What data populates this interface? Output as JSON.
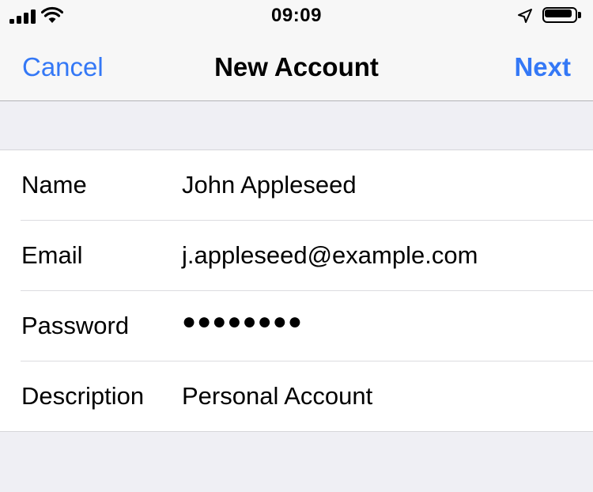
{
  "status_bar": {
    "time": "09:09",
    "signal_icon": "cellular-signal-icon",
    "wifi_icon": "wifi-icon",
    "location_icon": "location-arrow-icon",
    "battery_icon": "battery-icon",
    "battery_level": 0.9
  },
  "nav": {
    "cancel_label": "Cancel",
    "title": "New Account",
    "next_label": "Next",
    "accent_color": "#3478f6"
  },
  "form": {
    "rows": [
      {
        "label": "Name",
        "value": "John Appleseed"
      },
      {
        "label": "Email",
        "value": "j.appleseed@example.com"
      },
      {
        "label": "Password",
        "value": "●●●●●●●●"
      },
      {
        "label": "Description",
        "value": "Personal Account"
      }
    ]
  }
}
